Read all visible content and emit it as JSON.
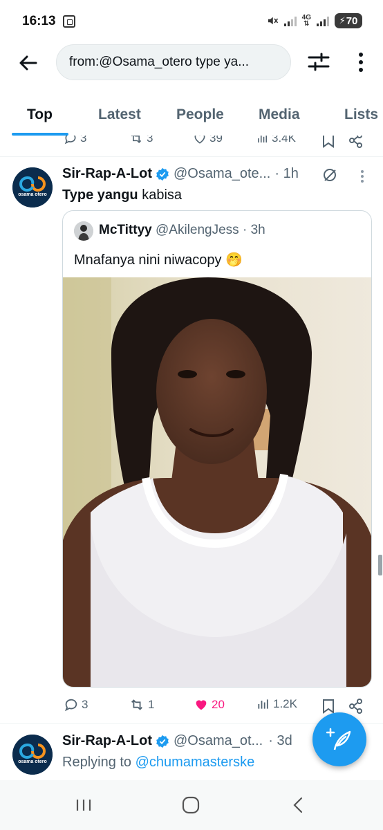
{
  "status_bar": {
    "time": "16:13",
    "network": "4G",
    "battery": "70"
  },
  "search": {
    "query": "from:@Osama_otero type ya..."
  },
  "tabs": [
    {
      "label": "Top",
      "active": true
    },
    {
      "label": "Latest",
      "active": false
    },
    {
      "label": "People",
      "active": false
    },
    {
      "label": "Media",
      "active": false
    },
    {
      "label": "Lists",
      "active": false
    }
  ],
  "previous_tweet_stats": {
    "replies": "3",
    "retweets": "3",
    "likes": "39",
    "views": "3.4K"
  },
  "tweets": [
    {
      "avatar_text": "osama otero",
      "name": "Sir-Rap-A-Lot",
      "handle": "@Osama_ote...",
      "time": "· 1h",
      "body_bold": "Type yangu",
      "body_rest": " kabisa",
      "quote": {
        "name": "McTittyy",
        "handle": "@AkilengJess",
        "time": "· 3h",
        "text": "Mnafanya nini niwacopy 🤭"
      },
      "stats": {
        "replies": "3",
        "retweets": "1",
        "likes": "20",
        "views": "1.2K"
      }
    },
    {
      "avatar_text": "osama otero",
      "name": "Sir-Rap-A-Lot",
      "handle": "@Osama_ot...",
      "time": "· 3d",
      "replying_prefix": "Replying to ",
      "replying_to": "@chumamasterske"
    }
  ],
  "colors": {
    "accent": "#1d9bf0",
    "like": "#f91880",
    "muted": "#536471",
    "text": "#0f1419"
  }
}
